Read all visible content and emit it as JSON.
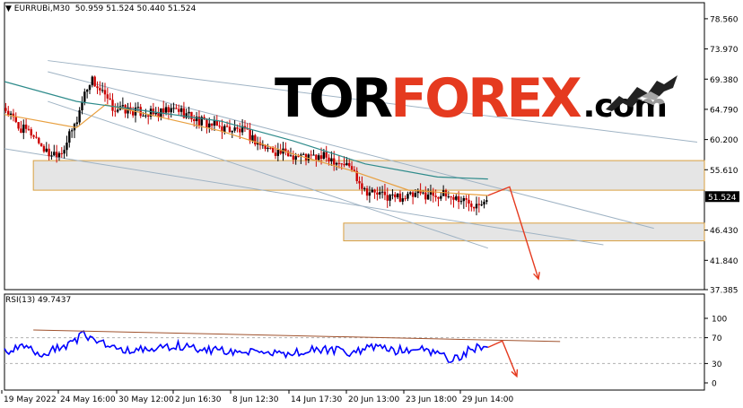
{
  "header": {
    "symbol_label": "EURRUBi,M30",
    "ohlc": "50.959 51.524 50.440 51.524"
  },
  "logo": {
    "part1": "TOR",
    "part2": "FOREX",
    "part3": ".com"
  },
  "indicator": {
    "label": "RSI(13) 49.7437"
  },
  "colors": {
    "bull": "#000000",
    "bear": "#cc0000",
    "ma_short": "#e8a040",
    "ma_long": "#2e8b8b",
    "rsi": "#0000ff",
    "accent": "#e53a1f",
    "zone": "#dcdcdc"
  },
  "chart_data": [
    {
      "type": "candlestick",
      "symbol": "EURRUBi",
      "timeframe": "M30",
      "open": 50.959,
      "high": 51.524,
      "low": 50.44,
      "close": 51.524,
      "ylim": [
        37.385,
        81.0
      ],
      "y_ticks": [
        "78.560",
        "73.970",
        "69.380",
        "64.790",
        "60.200",
        "55.610",
        "51.020",
        "46.430",
        "41.840",
        "37.385"
      ],
      "current_price_label": "51.524",
      "x_ticks": [
        "19 May 2022",
        "24 May 16:00",
        "30 May 12:00",
        "2 Jun 16:30",
        "8 Jun 12:30",
        "14 Jun 17:30",
        "20 Jun 13:00",
        "23 Jun 18:00",
        "29 Jun 14:00"
      ],
      "price_path": [
        [
          0,
          65.0
        ],
        [
          2,
          62.0
        ],
        [
          4,
          61.0
        ],
        [
          6,
          58.0
        ],
        [
          8,
          58.5
        ],
        [
          10,
          63.0
        ],
        [
          11,
          67.0
        ],
        [
          12,
          69.5
        ],
        [
          13,
          68.0
        ],
        [
          15,
          65.0
        ],
        [
          18,
          64.5
        ],
        [
          21,
          64.0
        ],
        [
          24,
          64.8
        ],
        [
          27,
          63.0
        ],
        [
          30,
          62.0
        ],
        [
          33,
          61.5
        ],
        [
          36,
          59.0
        ],
        [
          39,
          58.0
        ],
        [
          42,
          57.5
        ],
        [
          45,
          57.5
        ],
        [
          48,
          56.0
        ],
        [
          50,
          52.5
        ],
        [
          53,
          51.5
        ],
        [
          56,
          51.5
        ],
        [
          59,
          52.0
        ],
        [
          62,
          51.5
        ],
        [
          65,
          50.5
        ],
        [
          67,
          51.524
        ]
      ],
      "moving_averages": [
        {
          "path": [
            [
              0,
              64.0
            ],
            [
              10,
              62.0
            ],
            [
              14,
              65.5
            ],
            [
              22,
              63.5
            ],
            [
              30,
              61.5
            ],
            [
              40,
              58.0
            ],
            [
              48,
              55.5
            ],
            [
              56,
              52.5
            ],
            [
              67,
              51.7
            ]
          ]
        },
        {
          "path": [
            [
              0,
              69.0
            ],
            [
              10,
              66.0
            ],
            [
              20,
              64.5
            ],
            [
              30,
              63.0
            ],
            [
              40,
              60.0
            ],
            [
              50,
              56.5
            ],
            [
              60,
              54.5
            ],
            [
              67,
              54.2
            ]
          ]
        }
      ],
      "zones": [
        {
          "from": 52.5,
          "to": 57.0,
          "x_from": 4,
          "x_to": 97
        },
        {
          "from": 44.8,
          "to": 47.5,
          "x_from": 47,
          "x_to": 97
        }
      ],
      "trendlines": [
        {
          "p1": [
            6,
            72.2
          ],
          "p2": [
            96,
            59.8
          ]
        },
        {
          "p1": [
            6,
            70.5
          ],
          "p2": [
            90,
            46.7
          ]
        },
        {
          "p1": [
            6,
            66.0
          ],
          "p2": [
            67,
            43.7
          ]
        },
        {
          "p1": [
            0,
            58.8
          ],
          "p2": [
            83,
            44.2
          ]
        }
      ],
      "forecast_arrows": [
        {
          "points": [
            [
              67,
              51.7
            ],
            [
              70,
              53.0
            ],
            [
              74,
              39.0
            ]
          ]
        }
      ]
    },
    {
      "type": "line",
      "indicator": "RSI(13)",
      "current_value": 49.7437,
      "ylim": [
        0,
        100
      ],
      "y_ticks": [
        "100",
        "70",
        "30",
        "0"
      ],
      "levels": [
        70,
        30
      ],
      "rsi_path": [
        [
          0,
          48
        ],
        [
          3,
          55
        ],
        [
          5,
          40
        ],
        [
          7,
          52
        ],
        [
          9,
          60
        ],
        [
          11,
          75
        ],
        [
          13,
          65
        ],
        [
          15,
          55
        ],
        [
          18,
          50
        ],
        [
          21,
          52
        ],
        [
          24,
          58
        ],
        [
          27,
          52
        ],
        [
          30,
          50
        ],
        [
          33,
          48
        ],
        [
          36,
          44
        ],
        [
          39,
          46
        ],
        [
          42,
          50
        ],
        [
          45,
          52
        ],
        [
          48,
          46
        ],
        [
          51,
          55
        ],
        [
          54,
          50
        ],
        [
          57,
          54
        ],
        [
          60,
          48
        ],
        [
          62,
          35
        ],
        [
          64,
          48
        ],
        [
          66,
          58
        ],
        [
          67,
          49.74
        ]
      ],
      "trendline": {
        "p1": [
          4,
          82
        ],
        "p2": [
          77,
          64
        ]
      },
      "forecast_arrow": {
        "points": [
          [
            67,
            55
          ],
          [
            69,
            65
          ],
          [
            71,
            10
          ]
        ]
      }
    }
  ]
}
